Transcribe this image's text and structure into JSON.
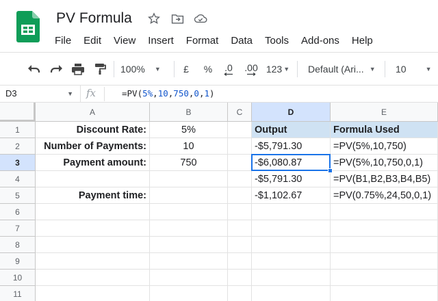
{
  "document": {
    "title": "PV Formula"
  },
  "menu": [
    "File",
    "Edit",
    "View",
    "Insert",
    "Format",
    "Data",
    "Tools",
    "Add-ons",
    "Help"
  ],
  "toolbar": {
    "zoom": "100%",
    "currency": "£",
    "percent": "%",
    "dec_decrease": ".0",
    "dec_increase": ".00",
    "more_formats": "123",
    "font": "Default (Ari...",
    "font_size": "10"
  },
  "formula_bar": {
    "cell_ref": "D3",
    "fx": "fx",
    "parts": [
      {
        "t": "=PV(",
        "c": "plain"
      },
      {
        "t": "5%",
        "c": "num"
      },
      {
        "t": ",",
        "c": "plain"
      },
      {
        "t": "10",
        "c": "num"
      },
      {
        "t": ",",
        "c": "plain"
      },
      {
        "t": "750",
        "c": "num"
      },
      {
        "t": ",",
        "c": "plain"
      },
      {
        "t": "0",
        "c": "num"
      },
      {
        "t": ",",
        "c": "plain"
      },
      {
        "t": "1",
        "c": "num"
      },
      {
        "t": ")",
        "c": "plain"
      }
    ]
  },
  "columns": [
    "A",
    "B",
    "C",
    "D",
    "E"
  ],
  "rows": [
    "1",
    "2",
    "3",
    "4",
    "5",
    "6",
    "7",
    "8",
    "9",
    "10",
    "11"
  ],
  "cells": {
    "A1": "Discount Rate:",
    "A2": "Number of Payments:",
    "A3": "Payment amount:",
    "A5": "Payment time:",
    "B1": "5%",
    "B2": "10",
    "B3": "750",
    "D1": "Output",
    "D2": "-$5,791.30",
    "D3": "-$6,080.87",
    "D4": "-$5,791.30",
    "D5": "-$1,102.67",
    "E1": "Formula Used",
    "E2": "=PV(5%,10,750)",
    "E3": "=PV(5%,10,750,0,1)",
    "E4": "=PV(B1,B2,B3,B4,B5)",
    "E5": "=PV(0.75%,24,50,0,1)"
  },
  "selected_cell": "D3",
  "colors": {
    "header_fill": "#cfe2f3",
    "selection": "#1a73e8",
    "logo": "#0f9d58"
  }
}
